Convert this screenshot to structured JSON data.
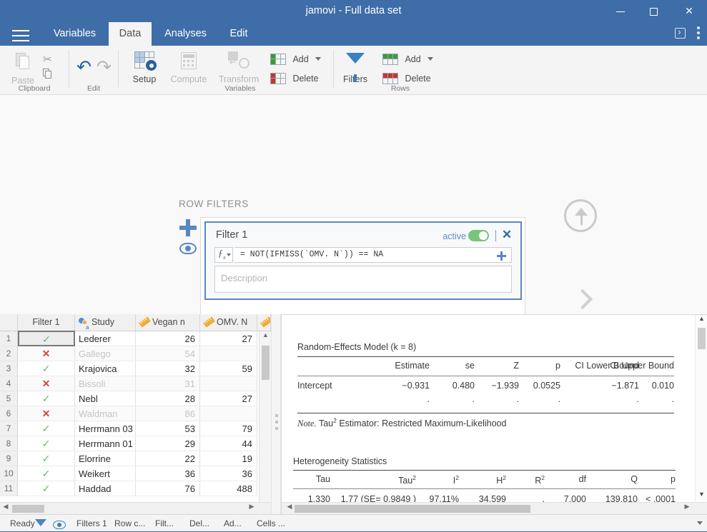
{
  "window": {
    "title": "jamovi - Full data set",
    "minimize_label": "minimize",
    "maximize_label": "maximize",
    "close_label": "✕"
  },
  "tabs": [
    {
      "label": "Variables",
      "active": false
    },
    {
      "label": "Data",
      "active": true
    },
    {
      "label": "Analyses",
      "active": false
    },
    {
      "label": "Edit",
      "active": false
    }
  ],
  "ribbon": {
    "groups": [
      {
        "name": "Clipboard",
        "label": "Clipboard"
      },
      {
        "name": "Edit",
        "label": "Edit"
      },
      {
        "name": "Variables",
        "label": "Variables"
      },
      {
        "name": "Rows",
        "label": "Rows"
      }
    ],
    "paste_label": "Paste",
    "setup_label": "Setup",
    "compute_label": "Compute",
    "transform_label": "Transform",
    "variables_add_label": "Add",
    "variables_delete_label": "Delete",
    "filters_label": "Filters",
    "rows_add_label": "Add",
    "rows_delete_label": "Delete"
  },
  "filter_panel": {
    "section_title": "ROW FILTERS",
    "filter": {
      "name": "Filter 1",
      "active_label": "active",
      "active": true,
      "close_label": "✕",
      "formula": "= NOT(IFMISS(`OMV. N`)) == NA",
      "description_placeholder": "Description"
    }
  },
  "spreadsheet": {
    "columns": [
      {
        "key": "filter",
        "label": "Filter 1",
        "icon": "filter-column-icon"
      },
      {
        "key": "study",
        "label": "Study",
        "icon": "nominal-icon"
      },
      {
        "key": "vegan",
        "label": "Vegan n",
        "icon": "continuous-ruler-icon"
      },
      {
        "key": "omv",
        "label": "OMV. N",
        "icon": "continuous-ruler-icon"
      }
    ],
    "rows": [
      {
        "num": "1",
        "filter": "✓",
        "included": true,
        "study": "Lederer",
        "vegan": "26",
        "omv": "27",
        "selected": true
      },
      {
        "num": "2",
        "filter": "✕",
        "included": false,
        "study": "Gallego",
        "vegan": "54",
        "omv": "",
        "selected": false
      },
      {
        "num": "3",
        "filter": "✓",
        "included": true,
        "study": "Krajovica",
        "vegan": "32",
        "omv": "59",
        "selected": false
      },
      {
        "num": "4",
        "filter": "✕",
        "included": false,
        "study": "Bissoli",
        "vegan": "31",
        "omv": "",
        "selected": false
      },
      {
        "num": "5",
        "filter": "✓",
        "included": true,
        "study": "Nebl",
        "vegan": "28",
        "omv": "27",
        "selected": false
      },
      {
        "num": "6",
        "filter": "✕",
        "included": false,
        "study": "Waldman",
        "vegan": "86",
        "omv": "",
        "selected": false
      },
      {
        "num": "7",
        "filter": "✓",
        "included": true,
        "study": "Herrmann 03",
        "vegan": "53",
        "omv": "79",
        "selected": false
      },
      {
        "num": "8",
        "filter": "✓",
        "included": true,
        "study": "Herrmann 01",
        "vegan": "29",
        "omv": "44",
        "selected": false
      },
      {
        "num": "9",
        "filter": "✓",
        "included": true,
        "study": "Elorrine",
        "vegan": "22",
        "omv": "19",
        "selected": false
      },
      {
        "num": "10",
        "filter": "✓",
        "included": true,
        "study": "Weikert",
        "vegan": "36",
        "omv": "36",
        "selected": false
      },
      {
        "num": "11",
        "filter": "✓",
        "included": true,
        "study": "Haddad",
        "vegan": "76",
        "omv": "488",
        "selected": false
      }
    ]
  },
  "results": {
    "model": {
      "title": "Random-Effects Model (k = 8)",
      "headers": [
        "",
        "Estimate",
        "se",
        "Z",
        "p",
        "CI Lower Bound",
        "CI Upper Bound"
      ],
      "rows": [
        {
          "label": "Intercept",
          "estimate": "−0.931",
          "se": "0.480",
          "z": "−1.939",
          "p": "0.0525",
          "ci_lower": "−1.871",
          "ci_upper": "0.010"
        }
      ],
      "dot_row": {
        "estimate": ".",
        "se": ".",
        "z": ".",
        "p": ".",
        "ci_lower": ".",
        "ci_upper": "."
      },
      "note_prefix": "Note.",
      "note_text": " Tau² Estimator: Restricted Maximum-Likelihood"
    },
    "heterogeneity": {
      "title": "Heterogeneity Statistics",
      "headers": [
        "Tau",
        "Tau²",
        "I²",
        "H²",
        "R²",
        "df",
        "Q",
        "p"
      ],
      "rows": [
        {
          "tau": "1.330",
          "tau2": "1.77 (SE= 0.9849 )",
          "i2": "97.11%",
          "h2": "34.599",
          "r2": ".",
          "df": "7.000",
          "q": "139.810",
          "p": "< .0001"
        }
      ]
    }
  },
  "statusbar": {
    "items": [
      {
        "name": "ready",
        "label": "Ready"
      },
      {
        "name": "filters-count",
        "label": "Filters 1"
      },
      {
        "name": "row-count",
        "label": "Row c..."
      },
      {
        "name": "filtered",
        "label": "Filt..."
      },
      {
        "name": "deleted",
        "label": "Del..."
      },
      {
        "name": "added",
        "label": "Ad..."
      },
      {
        "name": "cells",
        "label": "Cells ..."
      }
    ]
  },
  "colors": {
    "titlebar": "#3e6da8",
    "accent": "#5b87bf",
    "toggle_on": "#7ac47a",
    "included_check": "#6cb86c",
    "excluded_x": "#d04a3f"
  }
}
